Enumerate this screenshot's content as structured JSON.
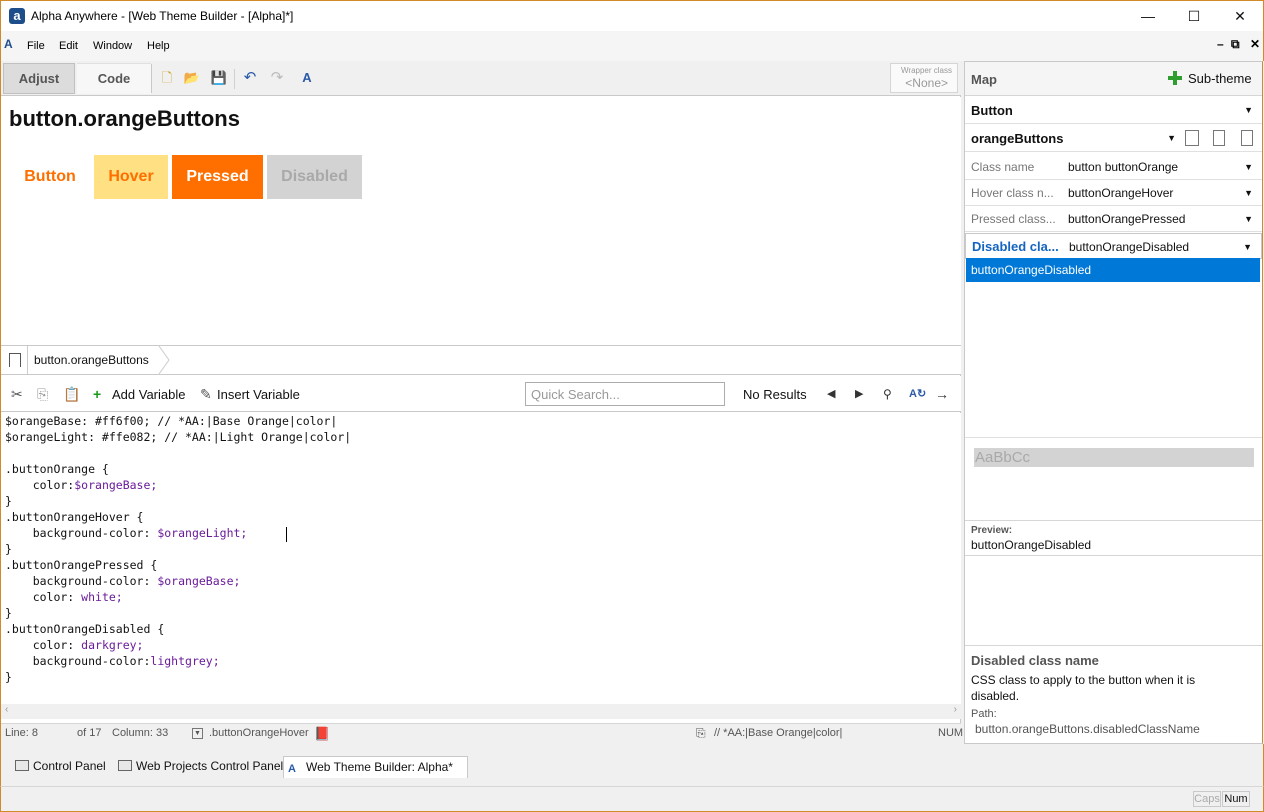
{
  "window": {
    "title": "Alpha Anywhere - [Web Theme Builder - [Alpha]*]",
    "logo_letter": "a",
    "minimize": "—",
    "maximize": "☐",
    "close": "✕"
  },
  "menu": {
    "logo": "A",
    "items": [
      "File",
      "Edit",
      "Window",
      "Help"
    ]
  },
  "toolbar": {
    "tabs": [
      "Adjust",
      "Code"
    ],
    "wrapper_label": "Wrapper class",
    "wrapper_value": "<None>"
  },
  "preview": {
    "title": "button.orangeButtons",
    "buttons": [
      "Button",
      "Hover",
      "Pressed",
      "Disabled"
    ]
  },
  "breadcrumb": {
    "path": "button.orangeButtons"
  },
  "codebar": {
    "add_variable": "Add Variable",
    "insert_variable": "Insert Variable",
    "search_placeholder": "Quick Search...",
    "search_result": "No Results"
  },
  "code": {
    "l1a": "$orangeBase: #ff6f00; // *AA:|Base Orange|color|",
    "l2a": "$orangeLight: #ffe082; // *AA:|Light Orange|color|",
    "l3": "",
    "l4": ".buttonOrange {",
    "l5k": "    color:",
    "l5v": "$orangeBase;",
    "l6": "}",
    "l7": ".buttonOrangeHover {",
    "l8k": "    background-color: ",
    "l8v": "$orangeLight;",
    "l9": "}",
    "l10": ".buttonOrangePressed {",
    "l11k": "    background-color: ",
    "l11v": "$orangeBase;",
    "l12k": "    color: ",
    "l12v": "white;",
    "l13": "}",
    "l14": ".buttonOrangeDisabled {",
    "l15k": "    color: ",
    "l15v": "darkgrey;",
    "l16k": "    background-color:",
    "l16v": "lightgrey;",
    "l17": "}"
  },
  "editor_status": {
    "line": "Line: 8",
    "of": "of 17",
    "column": "Column: 33",
    "selector": ".buttonOrangeHover",
    "comment": "// *AA:|Base Orange|color|",
    "num": "NUM"
  },
  "map": {
    "title": "Map",
    "subtheme": "Sub-theme",
    "type": "Button",
    "subtheme_name": "orangeButtons",
    "props": [
      {
        "key": "Class name",
        "value": "button buttonOrange"
      },
      {
        "key": "Hover class n...",
        "value": "buttonOrangeHover"
      },
      {
        "key": "Pressed class...",
        "value": "buttonOrangePressed"
      },
      {
        "key": "Disabled cla...",
        "value": "buttonOrangeDisabled"
      }
    ],
    "dropdown_option": "buttonOrangeDisabled",
    "sample": "AaBbCc",
    "preview_label": "Preview:",
    "preview_value": "buttonOrangeDisabled",
    "help_title": "Disabled class name",
    "help_desc": "CSS class to apply to the button when it is disabled.",
    "path_label": "Path:",
    "path_value": "button.orangeButtons.disabledClassName"
  },
  "doc_tabs": [
    "Control Panel",
    "Web Projects Control Panel",
    "Web Theme Builder: Alpha*"
  ],
  "app_status": {
    "caps": "Caps",
    "num": "Num"
  },
  "colors": {
    "orange_base": "#ff6f00",
    "orange_light": "#ffe082",
    "selection": "#0078d7"
  }
}
